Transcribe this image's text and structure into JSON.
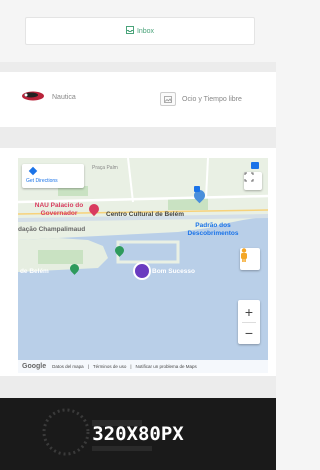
{
  "inbox": {
    "label": "Inbox",
    "icon": "inbox-icon"
  },
  "categories": [
    {
      "label": "Nautica",
      "icon": "motorboat-icon"
    },
    {
      "label": "Ocio y Tiempo libre",
      "icon": "leisure-icon"
    }
  ],
  "map": {
    "directions_label": "Get Directions",
    "street_label": "Praça Palm",
    "places": [
      "NAU Palacio do Governador",
      "Centro Cultural de Belém",
      "Padrão dos Descobrimentos",
      "dação Champalimaud",
      "Torre de Belém",
      "Bom Sucesso"
    ],
    "footer": {
      "logo": "Google",
      "links": [
        "Datos del mapa",
        "Términos de uso",
        "Notificar un problema de Maps"
      ]
    },
    "controls": {
      "zoom_in": "+",
      "zoom_out": "−"
    }
  },
  "ad": {
    "label": "320X80PX"
  },
  "colors": {
    "accent": "#4aa37a",
    "water": "#b9cfe8",
    "land": "#e9f0e4",
    "marker": "#6a3cc0"
  }
}
